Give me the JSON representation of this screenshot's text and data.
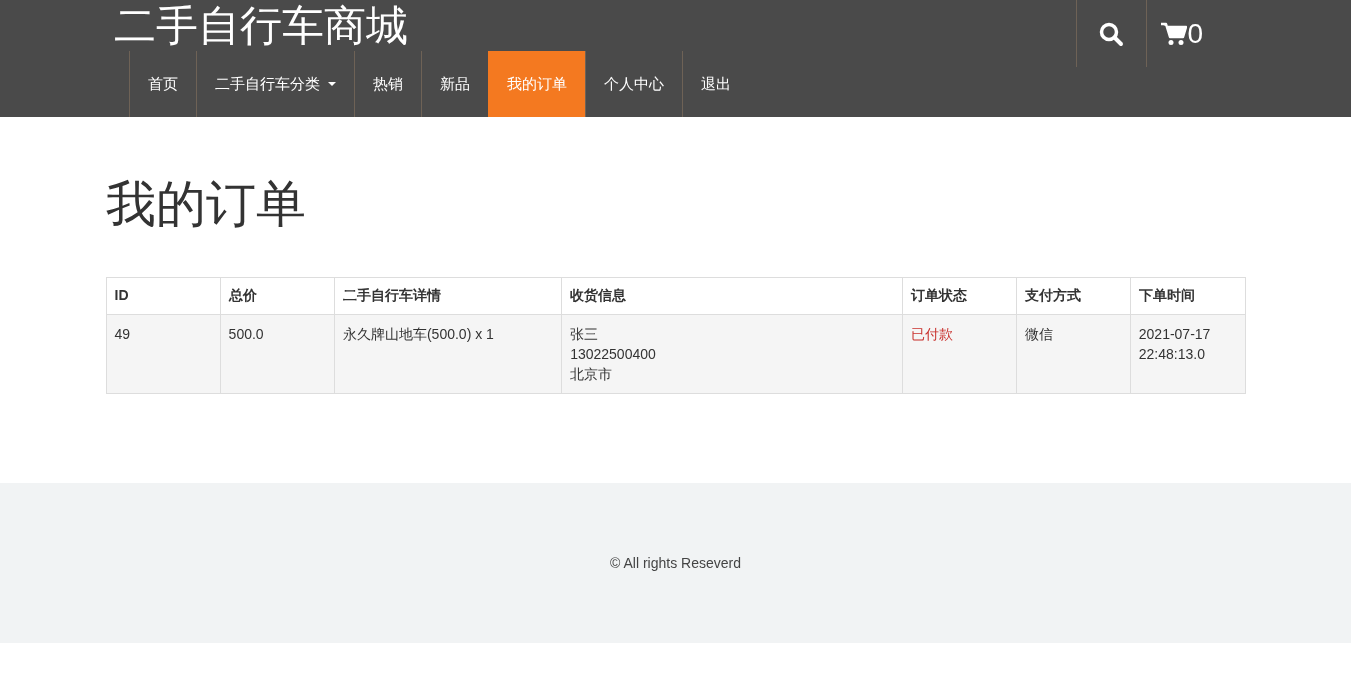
{
  "header": {
    "logo": "二手自行车商城",
    "nav": [
      {
        "label": "首页",
        "kind": "link",
        "selected": false
      },
      {
        "label": "二手自行车分类",
        "kind": "dropdown",
        "selected": false
      },
      {
        "label": "热销",
        "kind": "link",
        "selected": false
      },
      {
        "label": "新品",
        "kind": "link",
        "selected": false
      },
      {
        "label": "我的订单",
        "kind": "link",
        "selected": true
      },
      {
        "label": "个人中心",
        "kind": "link",
        "selected": false
      },
      {
        "label": "退出",
        "kind": "link",
        "selected": false
      }
    ],
    "cart_count": "0"
  },
  "page_title": "我的订单",
  "table": {
    "columns": [
      "ID",
      "总价",
      "二手自行车详情",
      "收货信息",
      "订单状态",
      "支付方式",
      "下单时间"
    ],
    "rows": [
      {
        "id": "49",
        "total": "500.0",
        "details": "永久牌山地车(500.0) x 1",
        "shipping": [
          "张三",
          "13022500400",
          "北京市"
        ],
        "status": "已付款",
        "payment": "微信",
        "time": "2021-07-17 22:48:13.0"
      }
    ]
  },
  "footer": {
    "text": "© All rights Reseverd"
  }
}
